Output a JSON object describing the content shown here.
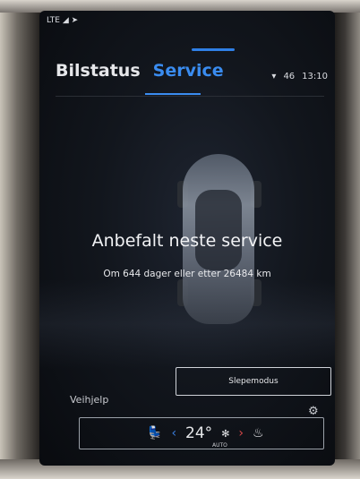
{
  "status_left": "LTE",
  "tabs": [
    {
      "label": "Bilstatus",
      "active": false
    },
    {
      "label": "Service",
      "active": true
    }
  ],
  "status_right": {
    "signal": "46",
    "time": "13:10"
  },
  "service": {
    "title": "Anbefalt neste service",
    "subtitle": "Om 644 dager eller etter 26484 km"
  },
  "roadside_label": "Veihjelp",
  "tow_label": "Slepemodus",
  "climate": {
    "temperature": "24°",
    "mode": "AUTO"
  },
  "colors": {
    "accent": "#3a8cf0",
    "heat": "#e65a5a"
  },
  "icons": {
    "settings": "gear-icon",
    "apps": "apps-grid-icon"
  }
}
